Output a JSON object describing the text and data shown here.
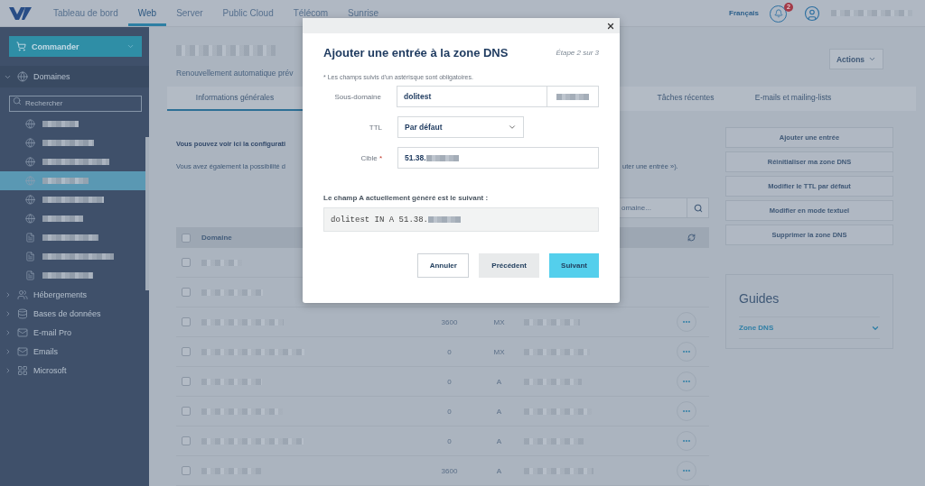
{
  "top_nav": {
    "items": [
      {
        "label": "Tableau de bord",
        "selected": false
      },
      {
        "label": "Web",
        "selected": true
      },
      {
        "label": "Server",
        "selected": false
      },
      {
        "label": "Public Cloud",
        "selected": false
      },
      {
        "label": "Télécom",
        "selected": false
      },
      {
        "label": "Sunrise",
        "selected": false
      }
    ],
    "language": "Français",
    "notification_count": "2"
  },
  "sidebar": {
    "order_button": "Commander",
    "section": {
      "label": "Domaines",
      "expanded": true,
      "search_placeholder": "Rechercher",
      "items": [
        {
          "kind": "domain",
          "selected": false
        },
        {
          "kind": "domain",
          "selected": false
        },
        {
          "kind": "domain",
          "selected": false
        },
        {
          "kind": "domain",
          "selected": true
        },
        {
          "kind": "domain",
          "selected": false
        },
        {
          "kind": "domain",
          "selected": false
        },
        {
          "kind": "zone",
          "selected": false
        },
        {
          "kind": "zone",
          "selected": false
        },
        {
          "kind": "zone",
          "selected": false
        }
      ]
    },
    "categories": [
      {
        "label": "Hébergements",
        "kind": "hosting",
        "expanded": false
      },
      {
        "label": "Bases de données",
        "kind": "database",
        "expanded": false
      },
      {
        "label": "E-mail Pro",
        "kind": "mail",
        "expanded": false
      },
      {
        "label": "Emails",
        "kind": "mail",
        "expanded": false
      },
      {
        "label": "Microsoft",
        "kind": "microsoft",
        "expanded": false
      }
    ]
  },
  "page": {
    "subtitle": "Renouvellement automatique prév",
    "actions_button": "Actions",
    "tabs": [
      {
        "label": "Informations générales",
        "selected": true
      },
      {
        "label": "Tâches récentes",
        "selected": false
      },
      {
        "label": "E-mails et mailing-lists",
        "selected": false
      }
    ],
    "intro_bold": "Vous pouvez voir ici la configurati",
    "intro_text": "Vous avez également la possibilité d",
    "intro_text_end": "uter une entrée »).",
    "search_placeholder": "omaine...",
    "table": {
      "columns": [
        "Domaine"
      ],
      "all_checked": false,
      "rows": [
        {
          "checked": false
        },
        {
          "checked": false
        },
        {
          "checked": false,
          "ttl": "3600",
          "type": "MX"
        },
        {
          "checked": false,
          "ttl": "0",
          "type": "MX"
        },
        {
          "checked": false,
          "ttl": "0",
          "type": "A"
        },
        {
          "checked": false,
          "ttl": "0",
          "type": "A"
        },
        {
          "checked": false,
          "ttl": "0",
          "type": "A"
        },
        {
          "checked": false,
          "ttl": "3600",
          "type": "A"
        }
      ]
    },
    "side_actions": [
      "Ajouter une entrée",
      "Réinitialiser ma zone DNS",
      "Modifier le TTL par défaut",
      "Modifier en mode textuel",
      "Supprimer la zone DNS"
    ],
    "guides": {
      "title": "Guides",
      "items": [
        {
          "label": "Zone DNS",
          "expanded": false
        }
      ]
    }
  },
  "dialog": {
    "title": "Ajouter une entrée à la zone DNS",
    "step": "Étape 2 sur 3",
    "note": "* Les champs suivis d'un astérisque sont obligatoires.",
    "fields": [
      {
        "kind": "text_suffix",
        "label": "Sous-domaine",
        "value": "dolitest"
      },
      {
        "kind": "select",
        "label": "TTL",
        "value": "Par défaut"
      },
      {
        "kind": "text",
        "label": "Cible",
        "value": "51.38.",
        "required_mark": "*"
      }
    ],
    "preview_label": "Le champ A actuellement généré est le suivant :",
    "preview": "dolitest IN A 51.38.",
    "buttons": [
      {
        "label": "Annuler",
        "kind": "secondary"
      },
      {
        "label": "Précédent",
        "kind": "muted"
      },
      {
        "label": "Suivant",
        "kind": "primary"
      }
    ]
  }
}
